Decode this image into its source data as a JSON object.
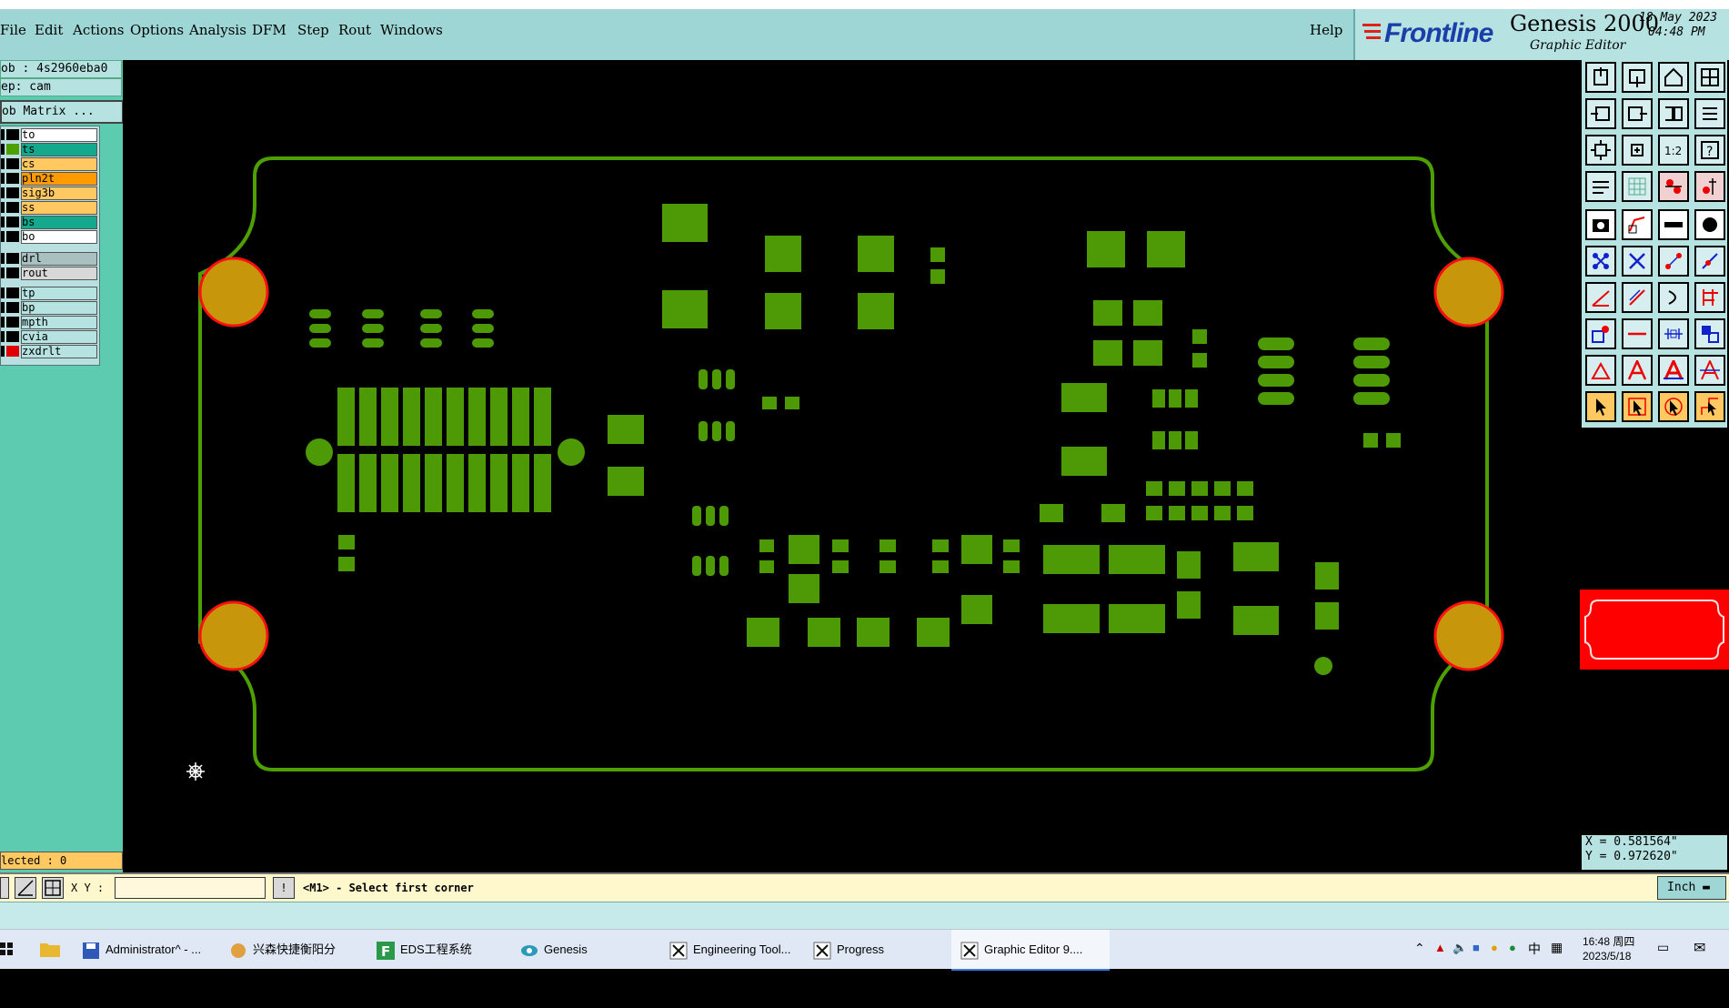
{
  "menubar": {
    "items": [
      "File",
      "Edit",
      "Actions",
      "Options",
      "Analysis",
      "DFM",
      "Step",
      "Rout",
      "Windows"
    ],
    "help": "Help"
  },
  "brand": {
    "logo": "Frontline",
    "product": "Genesis 2000",
    "subtitle": "Graphic Editor",
    "date": "18 May 2023",
    "time": "04:48 PM",
    "accent": "#1b3fa8"
  },
  "leftpanel": {
    "job": "ob : 4s2960eba0",
    "step": "ep: cam",
    "matrix_button": "ob Matrix ...",
    "layers": [
      {
        "name": "to",
        "color": "#ffffff",
        "swatch": "#000000"
      },
      {
        "name": "ts",
        "color": "#14a88c",
        "swatch": "#4ea000"
      },
      {
        "name": "cs",
        "color": "#ffc860",
        "swatch": "#000000"
      },
      {
        "name": "pln2t",
        "color": "#ff9a00",
        "swatch": "#000000"
      },
      {
        "name": "sig3b",
        "color": "#ffc860",
        "swatch": "#000000"
      },
      {
        "name": "ss",
        "color": "#ffc860",
        "swatch": "#000000"
      },
      {
        "name": "bs",
        "color": "#14a88c",
        "swatch": "#000000"
      },
      {
        "name": "bo",
        "color": "#ffffff",
        "swatch": "#000000"
      },
      {
        "name": "drl",
        "color": "#a8c0c0",
        "swatch": "#000000"
      },
      {
        "name": "rout",
        "color": "#d8d8d8",
        "swatch": "#000000"
      },
      {
        "name": "tp",
        "color": "#b6e2e2",
        "swatch": "#000000"
      },
      {
        "name": "bp",
        "color": "#b6e2e2",
        "swatch": "#000000"
      },
      {
        "name": "mpth",
        "color": "#b6e2e2",
        "swatch": "#000000"
      },
      {
        "name": "cvia",
        "color": "#b6e2e2",
        "swatch": "#000000"
      },
      {
        "name": "zxdrlt",
        "color": "#b6e2e2",
        "swatch": "#e00000"
      }
    ],
    "selected": "lected : 0"
  },
  "coords": {
    "x": "X = 0.581564\"",
    "y": "Y = 0.972620\""
  },
  "cmdline": {
    "xy_label": "X Y :",
    "xy_value": "",
    "prompt": "<M1> - Select first corner",
    "unit": "Inch"
  },
  "taskbar": {
    "items": [
      {
        "label": "Administrator^ - ...",
        "icon": "floppy-icon"
      },
      {
        "label": "兴森快捷衡阳分公...",
        "icon": "bird-icon"
      },
      {
        "label": "EDS工程系统",
        "icon": "f-app-icon"
      },
      {
        "label": "Genesis",
        "icon": "eye-icon"
      },
      {
        "label": "Engineering Tool...",
        "icon": "x-window-icon"
      },
      {
        "label": "Progress",
        "icon": "x-window-icon"
      },
      {
        "label": "Graphic Editor 9....",
        "icon": "x-window-icon"
      }
    ],
    "ime": "中",
    "clock_time": "16:48 周四",
    "clock_date": "2023/5/18"
  },
  "colors": {
    "board": "#4ea000",
    "pad": "#4e9a06",
    "hole": "#c8960a",
    "hole_ring": "#ff1010",
    "menu_bg": "#9ed6d6",
    "panel_bg": "#5ccbb0"
  }
}
